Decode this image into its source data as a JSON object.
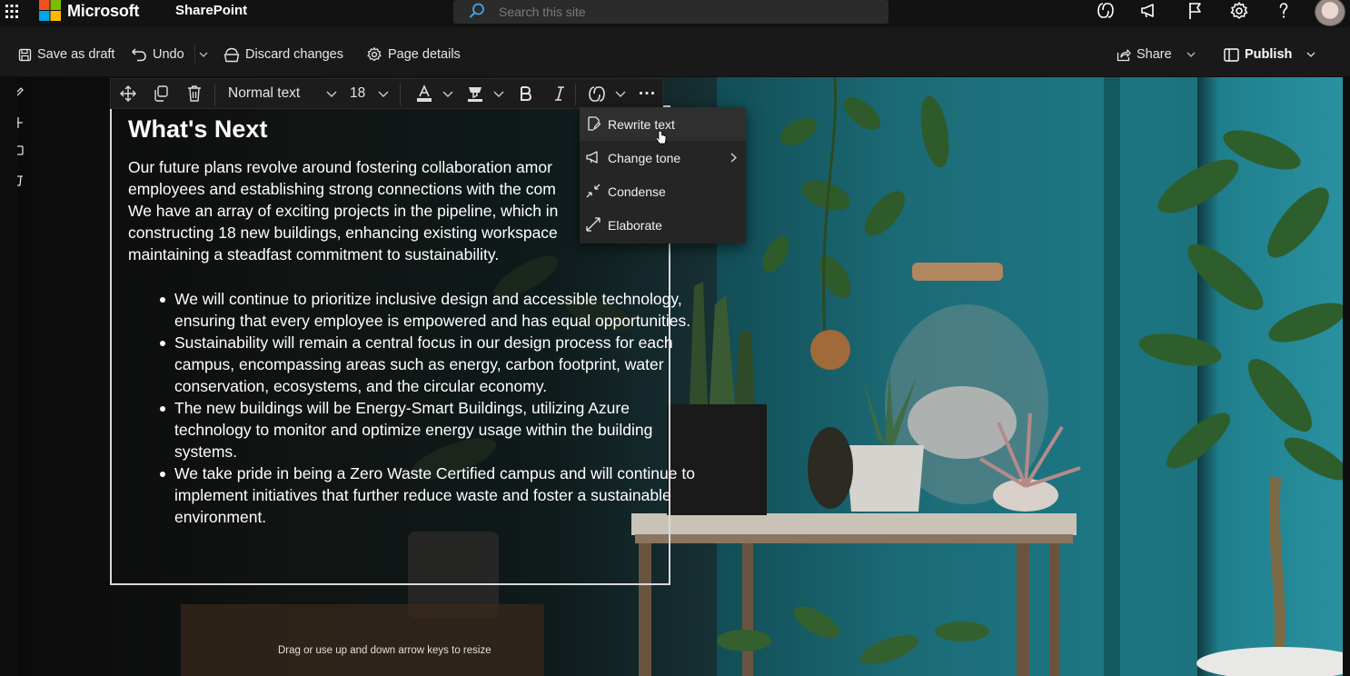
{
  "header": {
    "brand": "Microsoft",
    "app_name": "SharePoint",
    "search_placeholder": "Search this site",
    "icons": [
      "copilot-icon",
      "megaphone-icon",
      "flag-icon",
      "gear-icon",
      "help-icon"
    ]
  },
  "command_bar": {
    "save_draft": "Save as draft",
    "undo": "Undo",
    "discard": "Discard changes",
    "page_details": "Page details",
    "share": "Share",
    "publish": "Publish"
  },
  "toolbar": {
    "style": "Normal text",
    "font_size": "18"
  },
  "ai_menu": {
    "items": [
      {
        "label": "Rewrite text",
        "icon": "rewrite-icon"
      },
      {
        "label": "Change tone",
        "icon": "megaphone-icon"
      },
      {
        "label": "Condense",
        "icon": "collapse-icon"
      },
      {
        "label": "Elaborate",
        "icon": "expand-icon"
      }
    ]
  },
  "webpart": {
    "title": "What's Next",
    "paragraph_lines": [
      "Our future plans revolve around fostering collaboration amor",
      "employees and establishing strong connections with the com",
      "We have an array of exciting projects in the pipeline, which in",
      "constructing 18 new buildings, enhancing existing workspace",
      "maintaining a steadfast commitment to sustainability."
    ],
    "bullets": [
      "We will continue to prioritize inclusive design and accessible technology, ensuring that every employee is empowered and has equal opportunities.",
      "Sustainability will remain a central focus in our design process for each campus, encompassing areas such as energy, carbon footprint, water conservation, ecosystems, and the circular economy.",
      "The new buildings will be Energy-Smart Buildings, utilizing Azure technology to monitor and optimize energy usage within the building systems.",
      "We take pride in being a Zero Waste Certified campus and will continue to implement initiatives that further reduce waste and foster a sustainable environment."
    ],
    "resize_hint": "Drag or use up and down arrow keys to resize"
  },
  "colors": {
    "background": "#0f0f0f",
    "teal_wall": "#1d7682",
    "menu_bg": "#252525"
  }
}
